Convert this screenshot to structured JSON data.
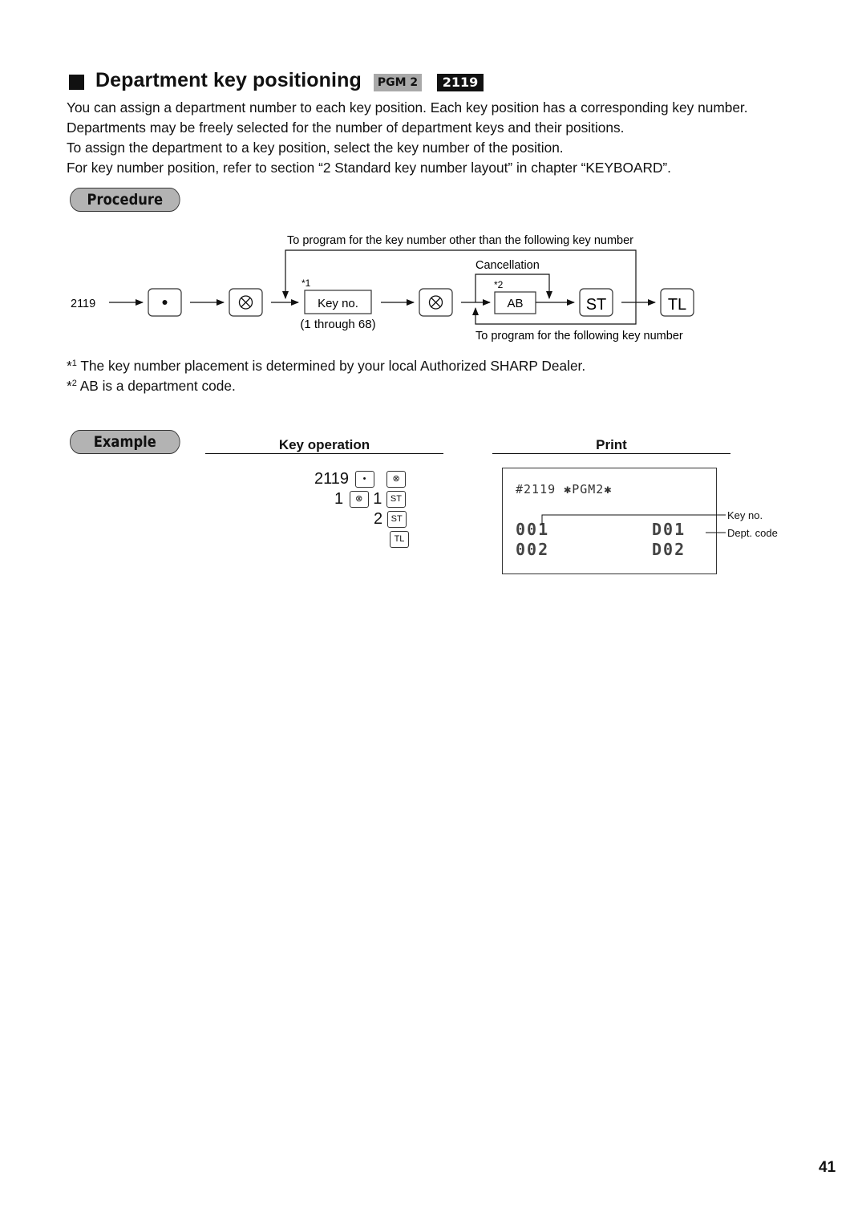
{
  "header": {
    "title": "Department key positioning",
    "mode_badge": "PGM 2",
    "job_code_badge": "2119"
  },
  "intro": [
    "You can assign a department number to each key position.  Each key position has a corresponding key number.",
    "Departments may be freely selected for the number of department keys and their positions.",
    "To assign the department to a key position, select the key number of the position.",
    "For key number position, refer to section “2 Standard key number layout” in chapter “KEYBOARD”."
  ],
  "procedure": {
    "heading": "Procedure",
    "start_label": "2119",
    "key_dot": "•",
    "key_multiply": "⊗",
    "key_no_box": "Key no.",
    "key_no_star": "*1",
    "key_no_range": "(1 through 68)",
    "ab_box": "AB",
    "ab_star": "*2",
    "cancellation_label": "Cancellation",
    "loop_top_label": "To program for the key number other than the following key number",
    "loop_bottom_label": "To program for the following key number",
    "key_st": "ST",
    "key_tl": "TL"
  },
  "footnotes": [
    {
      "mark": "1",
      "text": "The key number placement is determined by your local Authorized SHARP Dealer."
    },
    {
      "mark": "2",
      "text": "AB is a department code."
    }
  ],
  "example": {
    "heading": "Example",
    "key_operation_title": "Key operation",
    "print_title": "Print",
    "key_rows": [
      {
        "number": "2119",
        "keys": [
          "•",
          "⊗"
        ]
      },
      {
        "number": "1",
        "keys": [
          "⊗"
        ],
        "number2": "1",
        "keys2": [
          "ST"
        ]
      },
      {
        "number": "2",
        "keys": [
          "ST"
        ]
      },
      {
        "number": "",
        "keys": [
          "TL"
        ]
      }
    ],
    "receipt": {
      "header": "#2119 ✱PGM2✱",
      "rows": [
        {
          "key_no": "001",
          "dept_code": "D01"
        },
        {
          "key_no": "002",
          "dept_code": "D02"
        }
      ],
      "annotation_key_no": "Key no.",
      "annotation_dept_code": "Dept. code"
    }
  },
  "page_number": "41"
}
